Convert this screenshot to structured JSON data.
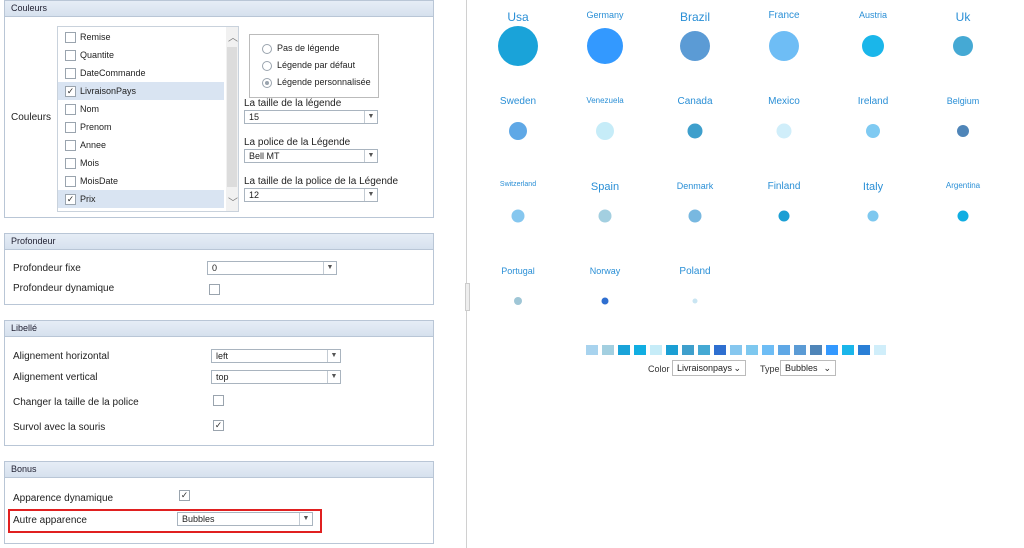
{
  "panels": {
    "couleurs": {
      "title": "Couleurs",
      "row_label": "Couleurs",
      "fields": [
        {
          "label": "Remise",
          "checked": false
        },
        {
          "label": "Quantite",
          "checked": false
        },
        {
          "label": "DateCommande",
          "checked": false
        },
        {
          "label": "LivraisonPays",
          "checked": true,
          "selected": true
        },
        {
          "label": "Nom",
          "checked": false
        },
        {
          "label": "Prenom",
          "checked": false
        },
        {
          "label": "Annee",
          "checked": false
        },
        {
          "label": "Mois",
          "checked": false
        },
        {
          "label": "MoisDate",
          "checked": false
        },
        {
          "label": "Prix",
          "checked": true,
          "selected": true
        }
      ],
      "legend_options": [
        "Pas de légende",
        "Légende par défaut",
        "Légende personnalisée"
      ],
      "legend_selected": 2,
      "legend_size_label": "La taille de la légende",
      "legend_size_value": "15",
      "legend_font_label": "La police de la Légende",
      "legend_font_value": "Bell MT",
      "legend_font_size_label": "La taille de la police de la Légende",
      "legend_font_size_value": "12"
    },
    "profondeur": {
      "title": "Profondeur",
      "fixed_label": "Profondeur fixe",
      "fixed_value": "0",
      "dynamic_label": "Profondeur dynamique",
      "dynamic_checked": false
    },
    "libelle": {
      "title": "Libellé",
      "h_align_label": "Alignement horizontal",
      "h_align_value": "left",
      "v_align_label": "Alignement vertical",
      "v_align_value": "top",
      "font_size_label": "Changer la taille de la police",
      "font_size_checked": false,
      "hover_label": "Survol avec la souris",
      "hover_checked": true
    },
    "bonus": {
      "title": "Bonus",
      "dynamic_label": "Apparence dynamique",
      "dynamic_checked": true,
      "other_label": "Autre apparence",
      "other_value": "Bubbles"
    }
  },
  "bubbles": [
    {
      "name": "Usa",
      "size": 40,
      "color": "#1aa3d9",
      "font": 12
    },
    {
      "name": "Germany",
      "size": 36,
      "color": "#3399ff",
      "font": 9
    },
    {
      "name": "Brazil",
      "size": 30,
      "color": "#5b9bd5",
      "font": 12
    },
    {
      "name": "France",
      "size": 30,
      "color": "#6ebdf5",
      "font": 10
    },
    {
      "name": "Austria",
      "size": 22,
      "color": "#1ab6ea",
      "font": 9
    },
    {
      "name": "Uk",
      "size": 20,
      "color": "#45a9d4",
      "font": 12
    },
    {
      "name": "Sweden",
      "size": 18,
      "color": "#5fa8e6",
      "font": 10
    },
    {
      "name": "Venezuela",
      "size": 18,
      "color": "#c6ecf8",
      "font": 8
    },
    {
      "name": "Canada",
      "size": 15,
      "color": "#3e9fcc",
      "font": 10
    },
    {
      "name": "Mexico",
      "size": 15,
      "color": "#d0eefa",
      "font": 10
    },
    {
      "name": "Ireland",
      "size": 14,
      "color": "#7fcaf2",
      "font": 10
    },
    {
      "name": "Belgium",
      "size": 12,
      "color": "#4f85b8",
      "font": 9
    },
    {
      "name": "Switzerland",
      "size": 13,
      "color": "#86c7ef",
      "font": 7
    },
    {
      "name": "Spain",
      "size": 13,
      "color": "#a3cfe0",
      "font": 11
    },
    {
      "name": "Denmark",
      "size": 13,
      "color": "#78b8e0",
      "font": 9
    },
    {
      "name": "Finland",
      "size": 11,
      "color": "#1b9fd4",
      "font": 10
    },
    {
      "name": "Italy",
      "size": 11,
      "color": "#7ec8ef",
      "font": 11
    },
    {
      "name": "Argentina",
      "size": 11,
      "color": "#11aee2",
      "font": 8
    },
    {
      "name": "Portugal",
      "size": 8,
      "color": "#9fc6d6",
      "font": 9
    },
    {
      "name": "Norway",
      "size": 7,
      "color": "#2f6fd0",
      "font": 9
    },
    {
      "name": "Poland",
      "size": 5,
      "color": "#c9e5f2",
      "font": 10
    }
  ],
  "swatches": [
    "#a8d3ee",
    "#a3cfe0",
    "#1aa3d9",
    "#11aee2",
    "#c6ecf8",
    "#1b9fd4",
    "#3e9fcc",
    "#45a9d4",
    "#2f6fd0",
    "#86c7ef",
    "#7ec8ef",
    "#6ebdf5",
    "#5fa8e6",
    "#5b9bd5",
    "#4f85b8",
    "#3399ff",
    "#1ab6ea",
    "#2a7fd6",
    "#d0eefa"
  ],
  "controls": {
    "color_label": "Color",
    "color_value": "Livraisonpays",
    "type_label": "Type",
    "type_value": "Bubbles"
  }
}
